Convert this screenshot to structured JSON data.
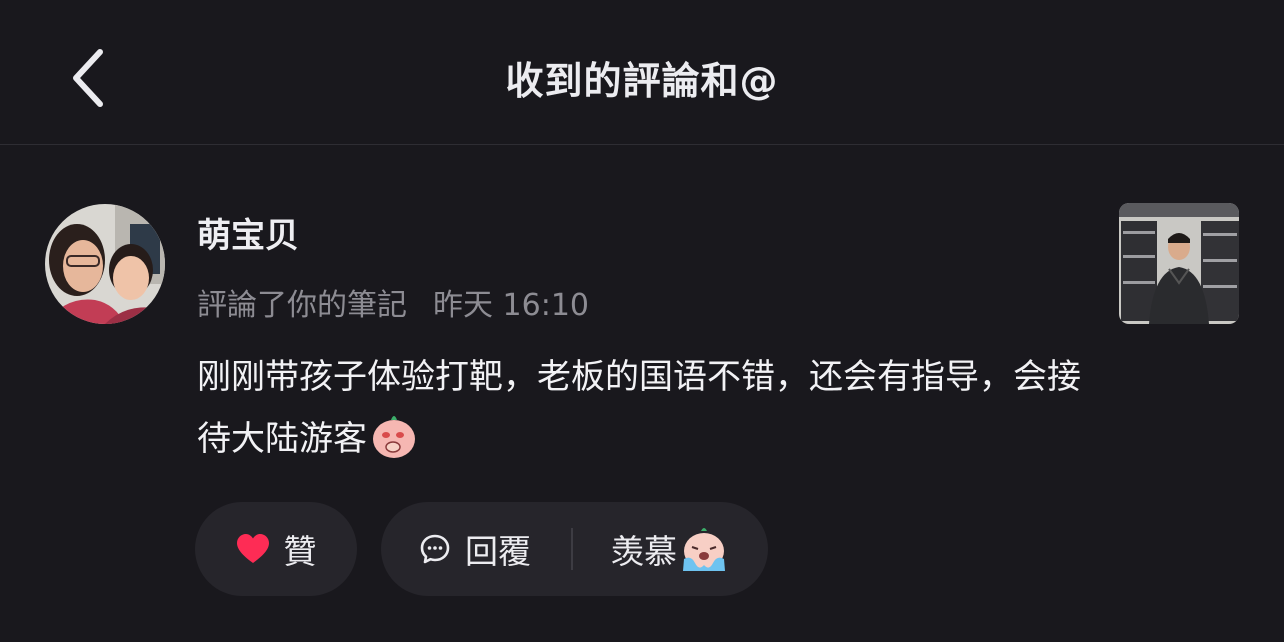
{
  "header": {
    "title": "收到的評論和@"
  },
  "notification": {
    "username": "萌宝贝",
    "action": "評論了你的筆記",
    "time": "昨天 16:10",
    "comment": "刚刚带孩子体验打靶，老板的国语不错，还会有指导，会接待大陆游客"
  },
  "actions": {
    "like_label": "贊",
    "reply_label": "回覆",
    "quick_reply_label": "羡慕"
  },
  "colors": {
    "background": "#19181d",
    "pill": "#26252b",
    "like_heart": "#fe2c55"
  },
  "icons": [
    "back-chevron-icon",
    "heart-icon",
    "comment-bubble-icon",
    "smitten-emoji",
    "crying-emoji"
  ]
}
